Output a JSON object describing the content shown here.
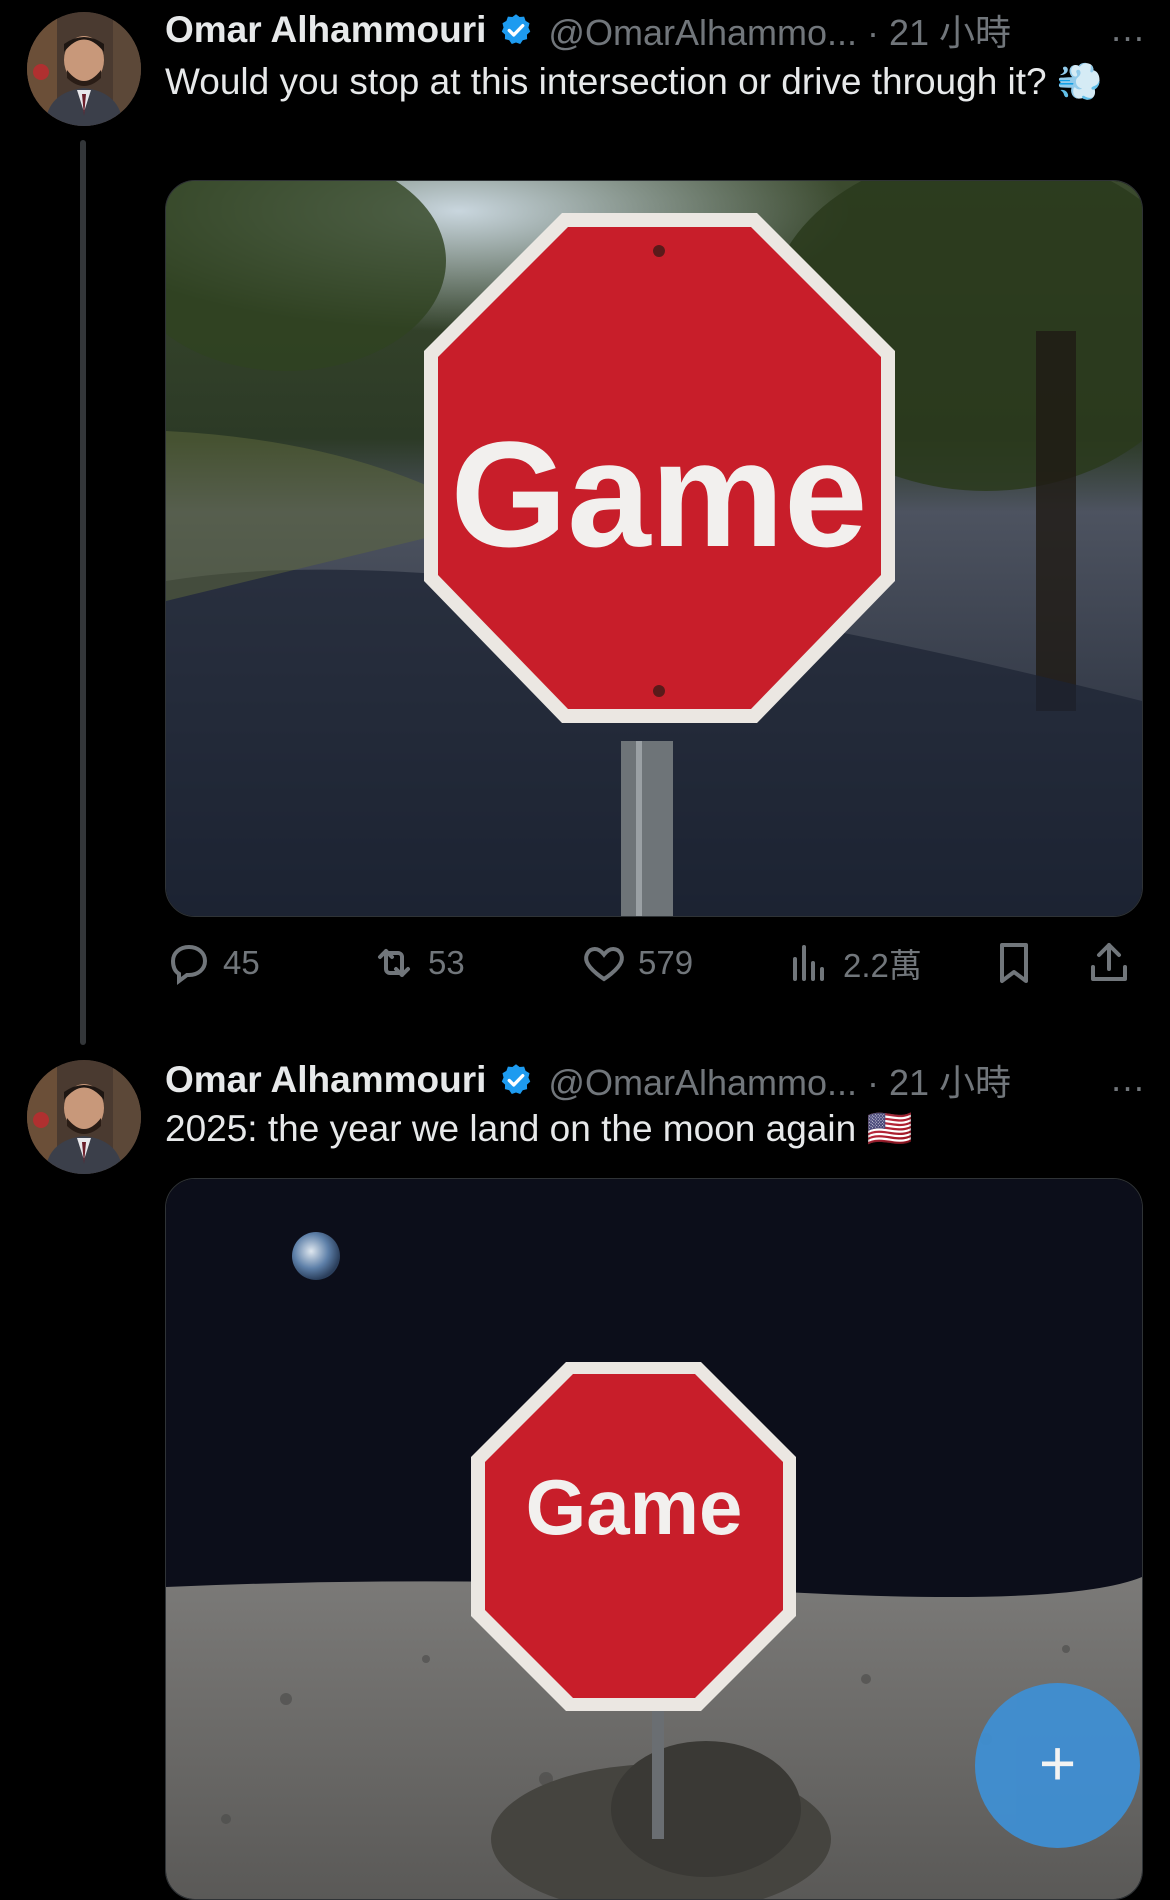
{
  "tweets": [
    {
      "author_name": "Omar Alhammouri",
      "handle_time": "@OmarAlhammo... · 21 小時",
      "text": "Would you stop at this intersection or drive through it? 💨",
      "media_sign_text": "Game",
      "stats": {
        "replies": "45",
        "reposts": "53",
        "likes": "579",
        "views": "2.2萬"
      }
    },
    {
      "author_name": "Omar Alhammouri",
      "handle_time": "@OmarAlhammo... · 21 小時",
      "text": "2025: the year we land on the moon again 🇺🇸",
      "media_sign_text": "Game"
    }
  ],
  "more_icon": "…",
  "fab_label": "+",
  "colors": {
    "background": "#000000",
    "text": "#e7e9ea",
    "muted": "#71767b",
    "verified": "#1d9bf0",
    "fab": "#3e90d6"
  }
}
